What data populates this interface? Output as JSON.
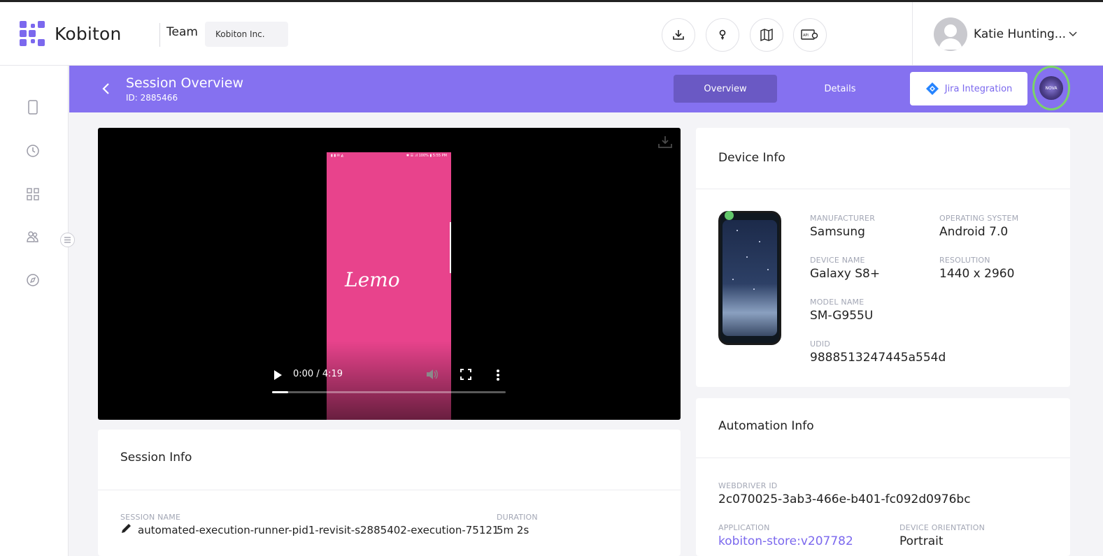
{
  "header": {
    "logo_text": "Kobiton",
    "team_label": "Team",
    "team_value": "Kobiton Inc.",
    "icons": [
      "download-icon",
      "help-icon",
      "map-icon",
      "api-settings-icon"
    ],
    "user_name": "Katie Hunting...",
    "accent_color": "#7b68ee"
  },
  "sidebar": {
    "icons": [
      "device-icon",
      "history-icon",
      "apps-grid-icon",
      "team-icon",
      "compass-icon",
      "menu-toggle-icon"
    ]
  },
  "session_bar": {
    "title": "Session Overview",
    "id_text": "ID: 2885466",
    "tabs": [
      {
        "label": "Overview",
        "active": true
      },
      {
        "label": "Details",
        "active": false
      }
    ],
    "jira_label": "Jira Integration",
    "nova_label": "NOVA",
    "bar_color": "#8571f0"
  },
  "video": {
    "app_name": "Lemo",
    "status_left": "▮ ▮ ✉ ◭",
    "status_right": "✱ ☰ .ıl 100% ▮ 5:55 PM",
    "time": "0:00 / 4:19",
    "progress_fraction": 0.07
  },
  "device_info": {
    "title": "Device Info",
    "fields": {
      "manufacturer_label": "MANUFACTURER",
      "manufacturer": "Samsung",
      "os_label": "OPERATING SYSTEM",
      "os": "Android 7.0",
      "device_name_label": "DEVICE NAME",
      "device_name": "Galaxy S8+",
      "resolution_label": "RESOLUTION",
      "resolution": "1440 x 2960",
      "model_label": "MODEL NAME",
      "model": "SM-G955U",
      "udid_label": "UDID",
      "udid": "9888513247445a554d"
    }
  },
  "automation_info": {
    "title": "Automation Info",
    "webdriver_label": "WEBDRIVER ID",
    "webdriver_id": "2c070025-3ab3-466e-b401-fc092d0976bc",
    "application_label": "APPLICATION",
    "application": "kobiton-store:v207782",
    "orientation_label": "DEVICE ORIENTATION",
    "orientation": "Portrait"
  },
  "session_info": {
    "title": "Session Info",
    "session_name_label": "SESSION NAME",
    "session_name": "automated-execution-runner-pid1-revisit-s2885402-execution-75121",
    "duration_label": "DURATION",
    "duration": "5m 2s"
  }
}
